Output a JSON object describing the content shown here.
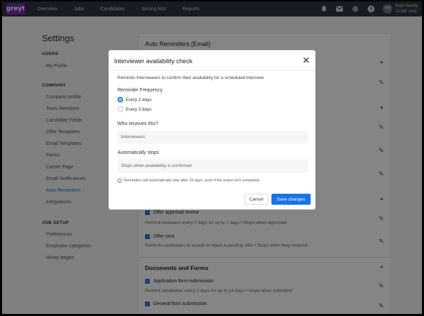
{
  "nav": {
    "logo": "greyt",
    "links": [
      "Overview",
      "Jobs",
      "Candidates",
      "Joining lists",
      "Reports"
    ],
    "user_initials": "RR",
    "user_name": "Rajni Reddy",
    "user_company": "ACME corp"
  },
  "settings": {
    "title": "Settings",
    "sections": [
      {
        "heading": "USERS",
        "items": [
          "My Profile"
        ]
      },
      {
        "heading": "COMPANY",
        "items": [
          "Company profile",
          "Team Members",
          "Candidate Fields",
          "Offer Templates",
          "Email Templates",
          "Forms",
          "Career Page",
          "Email Notifications",
          "Auto Reminders",
          "Integrations"
        ]
      },
      {
        "heading": "JOB SETUP",
        "items": [
          "Preferences",
          "Employee categories",
          "Hiring stages"
        ]
      }
    ],
    "active_item": "Auto Reminders"
  },
  "content": {
    "title": "Auto Reminders (Email)",
    "offer_rows": [
      {
        "title": "Offer approval review",
        "desc": "Remind reviewers every 2 days for up to 7 days • Stops when approved"
      },
      {
        "title": "Offer sent",
        "desc": "Reminds candidates to accept or reject a pending offer • Stops when they respond"
      }
    ],
    "docs_section": "Documents and Forms",
    "docs_rows": [
      {
        "title": "Application form submission",
        "desc": "Remind candidates every 2 days for up to 14 days • Stops when submitted"
      },
      {
        "title": "General form submission",
        "desc": ""
      }
    ]
  },
  "modal": {
    "title": "Interviewer availability check",
    "description": "Reminds Interviewers to confirm their availability for a scheduled interview",
    "frequency_label": "Reminder Frequency",
    "frequency_options": [
      "Every 2 days",
      "Every 3 days"
    ],
    "frequency_selected": "Every 2 days",
    "recipients_label": "Who receives this?",
    "recipients_value": "Interviewers",
    "stops_label": "Automatically stops",
    "stops_value": "Stops when availability is confirmed",
    "note": "Reminders will automatically stop after 10 days, even if the action isn't completed.",
    "cancel_label": "Cancel",
    "save_label": "Save changes"
  },
  "colors": {
    "accent": "#1a73e8",
    "logo": "#7a2bbd",
    "nav_bg": "#2e3440"
  }
}
